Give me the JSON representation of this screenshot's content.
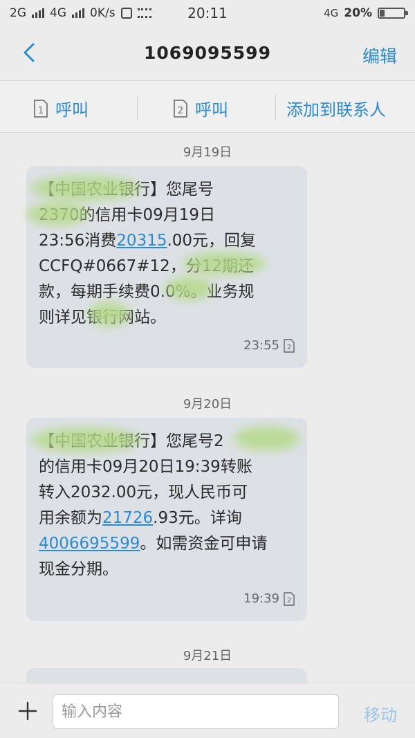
{
  "status_bar": {
    "left_text": "2G",
    "net2": "4G",
    "speed": "0K/s",
    "time": "20:11",
    "right_net": "4G",
    "battery": "20%",
    "battery_level": 0.2
  },
  "header": {
    "title": "1069095599",
    "edit_label": "编辑"
  },
  "actions": {
    "call1_label": "呼叫",
    "call2_label": "呼叫",
    "add_contact_label": "添加到联系人"
  },
  "messages": [
    {
      "date": "9月19日",
      "body_a": "【中国农业银行】您尾号\n2370的信用卡09月19日\n23:56消费",
      "link": "20315",
      "body_b": ".00元，回复\nCCFQ#0667#12，分12期还\n款，每期手续费0.0%。业务规\n则详见银行网站。",
      "link2": "",
      "body_c": "",
      "time": "23:55"
    },
    {
      "date": "9月20日",
      "body_a": "【中国农业银行】您尾号2\n的信用卡09月20日19:39转账\n转入2032.00元，现人民币可\n用余额为",
      "link": "21726",
      "body_b": ".93元。详询\n",
      "link2": "4006695599",
      "body_c": "。如需资金可申请\n现金分期。",
      "time": "19:39"
    },
    {
      "date": "9月21日"
    }
  ],
  "input": {
    "placeholder": "输入内容",
    "send_label": "移动"
  },
  "colors": {
    "accent": "#2a8bd4",
    "bubble": "#dde1e6",
    "background": "#ececec"
  }
}
